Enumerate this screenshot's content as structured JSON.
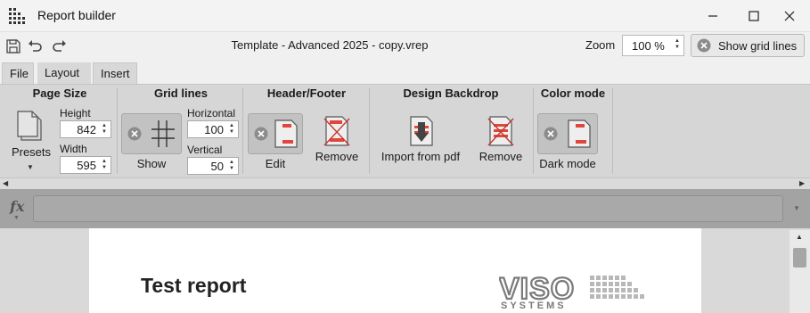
{
  "window": {
    "title": "Report builder",
    "app_icon": "dots-grid-icon",
    "minimize_icon": "minimize-icon",
    "maximize_icon": "maximize-icon",
    "close_icon": "close-icon"
  },
  "toolbar": {
    "filename": "Template - Advanced 2025 - copy.vrep",
    "zoom_label": "Zoom",
    "zoom_value": "100 %",
    "grid_button_label": "Show grid lines",
    "icons": [
      "save-icon",
      "undo-icon",
      "redo-icon"
    ]
  },
  "tabs": [
    {
      "label": "File",
      "active": false
    },
    {
      "label": "Layout",
      "active": true
    },
    {
      "label": "Insert",
      "active": false
    }
  ],
  "ribbon": {
    "page_size": {
      "title": "Page Size",
      "presets_label": "Presets",
      "height_label": "Height",
      "height_value": "842",
      "width_label": "Width",
      "width_value": "595"
    },
    "grid_lines": {
      "title": "Grid lines",
      "show_label": "Show",
      "horizontal_label": "Horizontal",
      "horizontal_value": "100",
      "vertical_label": "Vertical",
      "vertical_value": "50"
    },
    "header_footer": {
      "title": "Header/Footer",
      "edit_label": "Edit",
      "remove_label": "Remove"
    },
    "design_backdrop": {
      "title": "Design Backdrop",
      "import_label": "Import from pdf",
      "remove_label": "Remove"
    },
    "color_mode": {
      "title": "Color mode",
      "dark_label": "Dark mode"
    }
  },
  "formula": {
    "fx_label": "fx",
    "value": ""
  },
  "document": {
    "title": "Test report",
    "logo_text": "VISO SYSTEMS"
  },
  "colors": {
    "ribbon_bg": "#d6d6d6",
    "accent_red": "#e0463c",
    "formula_bg": "#a3a3a3"
  }
}
